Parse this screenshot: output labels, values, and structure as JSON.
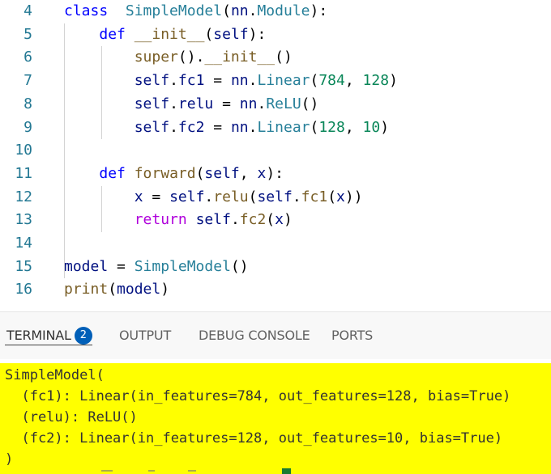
{
  "editor": {
    "lines": [
      {
        "num": "4",
        "tokens": [
          [
            "kw",
            "class"
          ],
          [
            "",
            "  "
          ],
          [
            "cls",
            "SimpleModel"
          ],
          [
            "",
            "("
          ],
          [
            "var",
            "nn"
          ],
          [
            "",
            "."
          ],
          [
            "cls",
            "Module"
          ],
          [
            "",
            "):"
          ]
        ]
      },
      {
        "num": "5",
        "tokens": [
          [
            "",
            "    "
          ],
          [
            "kw",
            "def"
          ],
          [
            "",
            ""
          ],
          [
            "fn",
            " __init__"
          ],
          [
            "",
            "("
          ],
          [
            "var",
            "self"
          ],
          [
            "",
            "):"
          ]
        ]
      },
      {
        "num": "6",
        "tokens": [
          [
            "",
            "        "
          ],
          [
            "fn",
            "super"
          ],
          [
            "",
            "()."
          ],
          [
            "fn",
            "__init__"
          ],
          [
            "",
            "()"
          ]
        ]
      },
      {
        "num": "7",
        "tokens": [
          [
            "",
            "        "
          ],
          [
            "var",
            "self"
          ],
          [
            "",
            "."
          ],
          [
            "var",
            "fc1"
          ],
          [
            "",
            " = "
          ],
          [
            "var",
            "nn"
          ],
          [
            "",
            "."
          ],
          [
            "cls",
            "Linear"
          ],
          [
            "",
            "("
          ],
          [
            "num",
            "784"
          ],
          [
            "",
            ", "
          ],
          [
            "num",
            "128"
          ],
          [
            "",
            ")"
          ]
        ]
      },
      {
        "num": "8",
        "tokens": [
          [
            "",
            "        "
          ],
          [
            "var",
            "self"
          ],
          [
            "",
            "."
          ],
          [
            "var",
            "relu"
          ],
          [
            "",
            " = "
          ],
          [
            "var",
            "nn"
          ],
          [
            "",
            "."
          ],
          [
            "cls",
            "ReLU"
          ],
          [
            "",
            "()"
          ]
        ]
      },
      {
        "num": "9",
        "tokens": [
          [
            "",
            "        "
          ],
          [
            "var",
            "self"
          ],
          [
            "",
            "."
          ],
          [
            "var",
            "fc2"
          ],
          [
            "",
            " = "
          ],
          [
            "var",
            "nn"
          ],
          [
            "",
            "."
          ],
          [
            "cls",
            "Linear"
          ],
          [
            "",
            "("
          ],
          [
            "num",
            "128"
          ],
          [
            "",
            ", "
          ],
          [
            "num",
            "10"
          ],
          [
            "",
            ")"
          ]
        ]
      },
      {
        "num": "10",
        "tokens": []
      },
      {
        "num": "11",
        "tokens": [
          [
            "",
            "    "
          ],
          [
            "kw",
            "def"
          ],
          [
            "",
            " "
          ],
          [
            "fn",
            "forward"
          ],
          [
            "",
            "("
          ],
          [
            "var",
            "self"
          ],
          [
            "",
            ", "
          ],
          [
            "var",
            "x"
          ],
          [
            "",
            "):"
          ]
        ]
      },
      {
        "num": "12",
        "tokens": [
          [
            "",
            "        "
          ],
          [
            "var",
            "x"
          ],
          [
            "",
            " = "
          ],
          [
            "var",
            "self"
          ],
          [
            "",
            "."
          ],
          [
            "fn",
            "relu"
          ],
          [
            "",
            "("
          ],
          [
            "var",
            "self"
          ],
          [
            "",
            "."
          ],
          [
            "fn",
            "fc1"
          ],
          [
            "",
            "("
          ],
          [
            "var",
            "x"
          ],
          [
            "",
            "))"
          ]
        ]
      },
      {
        "num": "13",
        "tokens": [
          [
            "",
            "        "
          ],
          [
            "kw2",
            "return"
          ],
          [
            "",
            " "
          ],
          [
            "var",
            "self"
          ],
          [
            "",
            "."
          ],
          [
            "fn",
            "fc2"
          ],
          [
            "",
            "("
          ],
          [
            "var",
            "x"
          ],
          [
            "",
            ")"
          ]
        ]
      },
      {
        "num": "14",
        "tokens": []
      },
      {
        "num": "15",
        "tokens": [
          [
            "var",
            "model"
          ],
          [
            "",
            " = "
          ],
          [
            "cls",
            "SimpleModel"
          ],
          [
            "",
            "()"
          ]
        ]
      },
      {
        "num": "16",
        "tokens": [
          [
            "fn",
            "print"
          ],
          [
            "",
            "("
          ],
          [
            "var",
            "model"
          ],
          [
            "",
            ")"
          ]
        ]
      }
    ]
  },
  "panel": {
    "tabs": [
      {
        "label": "TERMINAL",
        "badge": "2",
        "active": true
      },
      {
        "label": "OUTPUT",
        "active": false
      },
      {
        "label": "DEBUG CONSOLE",
        "active": false
      },
      {
        "label": "PORTS",
        "active": false
      }
    ]
  },
  "terminal": {
    "lines": [
      "SimpleModel(",
      "  (fc1): Linear(in_features=784, out_features=128, bias=True)",
      "  (relu): ReLU()",
      "  (fc2): Linear(in_features=128, out_features=10, bias=True)",
      ")"
    ],
    "background": "#ffff00"
  },
  "colors": {
    "keyword": "#0000ff",
    "control_keyword": "#af00db",
    "class_name": "#267f99",
    "function_name": "#795e26",
    "number": "#098658",
    "variable": "#001080",
    "line_number": "#237893",
    "badge": "#005fb8"
  }
}
